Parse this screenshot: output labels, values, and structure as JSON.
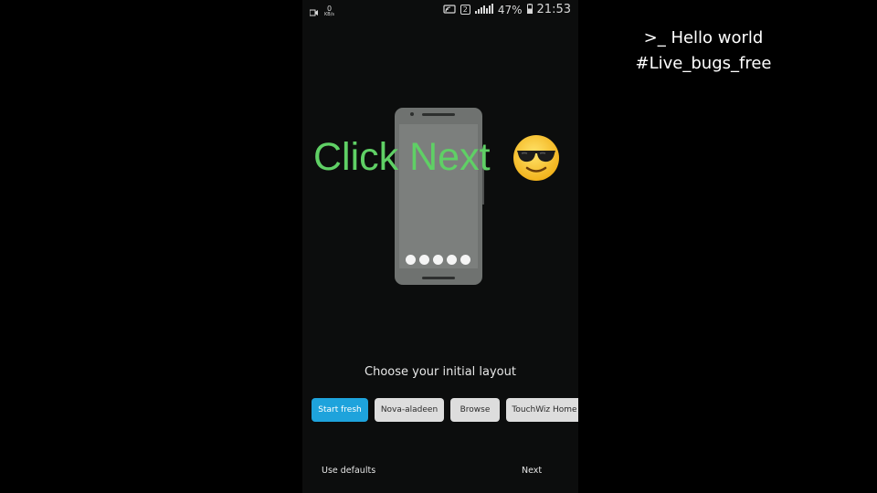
{
  "status_bar": {
    "net_speed_value": "0",
    "net_speed_unit": "KB/s",
    "sim_slot": "2",
    "battery": "47%",
    "time": "21:53"
  },
  "overlay": {
    "title": "Click Next",
    "emoji_icon": "sunglasses-face-icon"
  },
  "setup": {
    "prompt": "Choose your initial layout",
    "options": [
      {
        "label": "Start fresh",
        "selected": true
      },
      {
        "label": "Nova-aladeen",
        "selected": false
      },
      {
        "label": "Browse",
        "selected": false
      },
      {
        "label": "TouchWiz Home",
        "selected": false
      }
    ],
    "use_defaults_label": "Use defaults",
    "next_label": "Next"
  },
  "caption": {
    "line1": ">_ Hello world",
    "line2": "#Live_bugs_free"
  },
  "colors": {
    "accent": "#1ea3dc",
    "overlay_text": "#5fd065",
    "background": "#000000"
  }
}
